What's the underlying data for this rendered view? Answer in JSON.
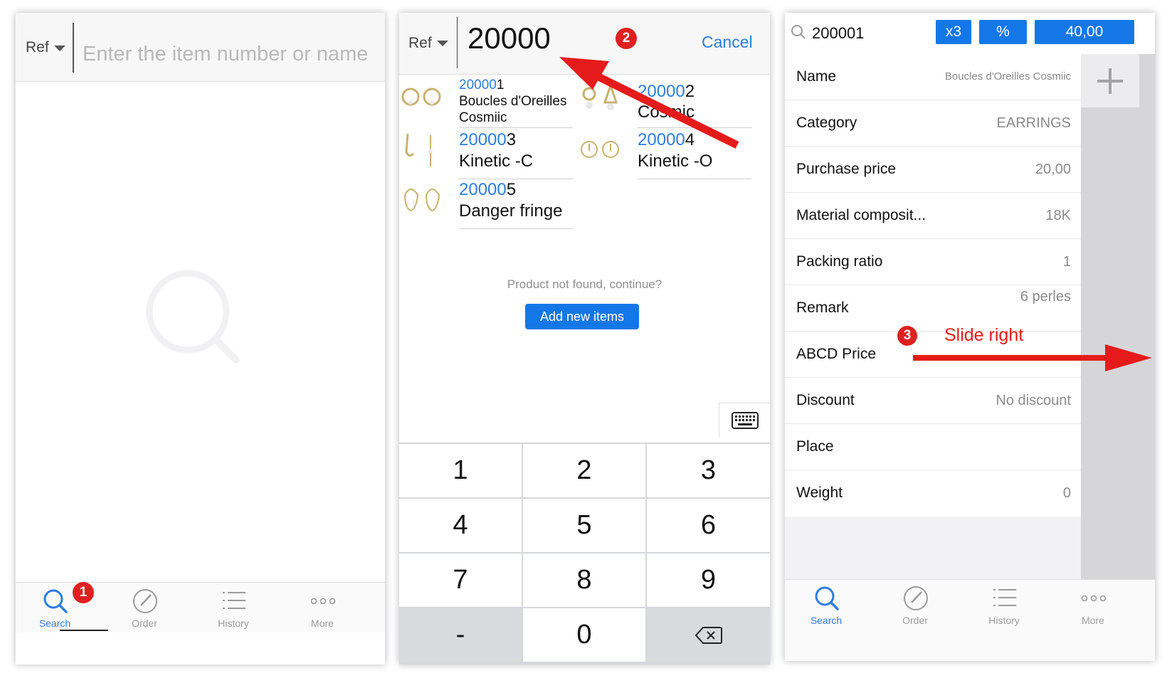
{
  "panel1": {
    "ref_label": "Ref",
    "search_placeholder": "Enter the item number or name",
    "badge": "1"
  },
  "panel2": {
    "ref_label": "Ref",
    "query": "20000",
    "cancel": "Cancel",
    "badge": "2",
    "products": [
      {
        "ref_prefix": "20000",
        "ref_suffix": "1",
        "name": "Boucles d'Oreilles Cosmiic"
      },
      {
        "ref_prefix": "20000",
        "ref_suffix": "2",
        "name": "Cosmic"
      },
      {
        "ref_prefix": "20000",
        "ref_suffix": "3",
        "name": "Kinetic  -C"
      },
      {
        "ref_prefix": "20000",
        "ref_suffix": "4",
        "name": "Kinetic  -O"
      },
      {
        "ref_prefix": "20000",
        "ref_suffix": "5",
        "name": "Danger fringe"
      }
    ],
    "not_found": "Product not found, continue?",
    "add_button": "Add new items",
    "keys": [
      "1",
      "2",
      "3",
      "4",
      "5",
      "6",
      "7",
      "8",
      "9",
      "-",
      "0",
      "backspace"
    ]
  },
  "panel3": {
    "query": "200001",
    "qty": "x3",
    "percent": "%",
    "price": "40,00",
    "badge": "3",
    "hint": "Slide right",
    "details": [
      {
        "label": "Name",
        "value": "Boucles d'Oreilles Cosmiic"
      },
      {
        "label": "Category",
        "value": "EARRINGS"
      },
      {
        "label": "Purchase price",
        "value": "20,00"
      },
      {
        "label": "Material composit...",
        "value": "18K"
      },
      {
        "label": "Packing ratio",
        "value": "1"
      },
      {
        "label": "Remark",
        "value": "6 perles"
      },
      {
        "label": "ABCD Price",
        "value": ""
      },
      {
        "label": "Discount",
        "value": "No discount"
      },
      {
        "label": "Place",
        "value": ""
      },
      {
        "label": "Weight",
        "value": "0"
      }
    ]
  },
  "tabs": [
    {
      "label": "Search",
      "icon": "search-icon"
    },
    {
      "label": "Order",
      "icon": "pencil-icon"
    },
    {
      "label": "History",
      "icon": "list-icon"
    },
    {
      "label": "More",
      "icon": "more-icon"
    }
  ],
  "colors": {
    "accent": "#2e7de1",
    "button": "#1477e8",
    "annotation": "#e02020"
  }
}
